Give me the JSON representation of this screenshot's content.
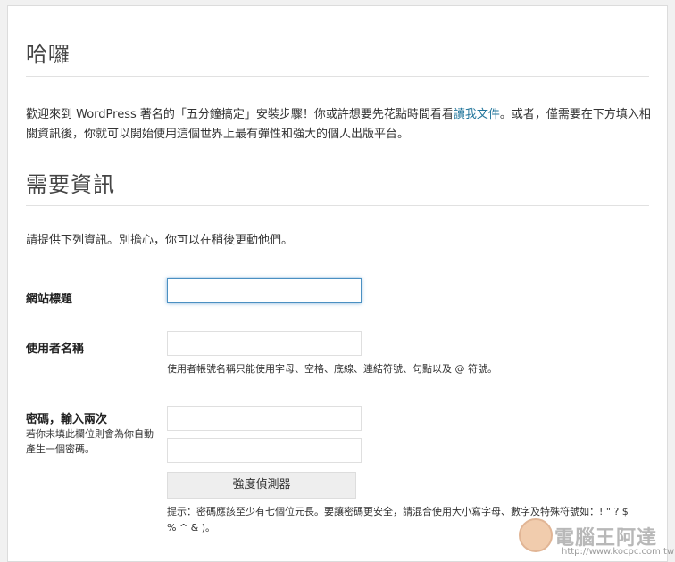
{
  "hello_heading": "哈囉",
  "welcome": {
    "text_before": "歡迎來到 WordPress 著名的「五分鐘搞定」安裝步驟！你或許想要先花點時間看看",
    "link": "讀我文件",
    "text_after": "。或者，僅需要在下方填入相關資訊後，你就可以開始使用這個世界上最有彈性和強大的個人出版平台。"
  },
  "info_heading": "需要資訊",
  "info_text": "請提供下列資訊。別擔心，你可以在稍後更動他們。",
  "form": {
    "site_title_label": "網站標題",
    "site_title_value": "",
    "username_label": "使用者名稱",
    "username_value": "",
    "username_help": "使用者帳號名稱只能使用字母、空格、底線、連結符號、句點以及 @ 符號。",
    "password_label": "密碼，輸入兩次",
    "password_sublabel": "若你未填此欄位則會為你自動產生一個密碼。",
    "password1_value": "",
    "password2_value": "",
    "strength_meter": "強度偵測器",
    "password_hint": "提示：密碼應該至少有七個位元長。要讓密碼更安全，請混合使用大小寫字母、數字及特殊符號如：! \" ? $ % ^ & )。"
  },
  "watermark": {
    "title": "電腦王阿達",
    "url": "http://www.kocpc.com.tw"
  },
  "colors": {
    "link": "#21759b",
    "focus": "#4a90c2"
  }
}
